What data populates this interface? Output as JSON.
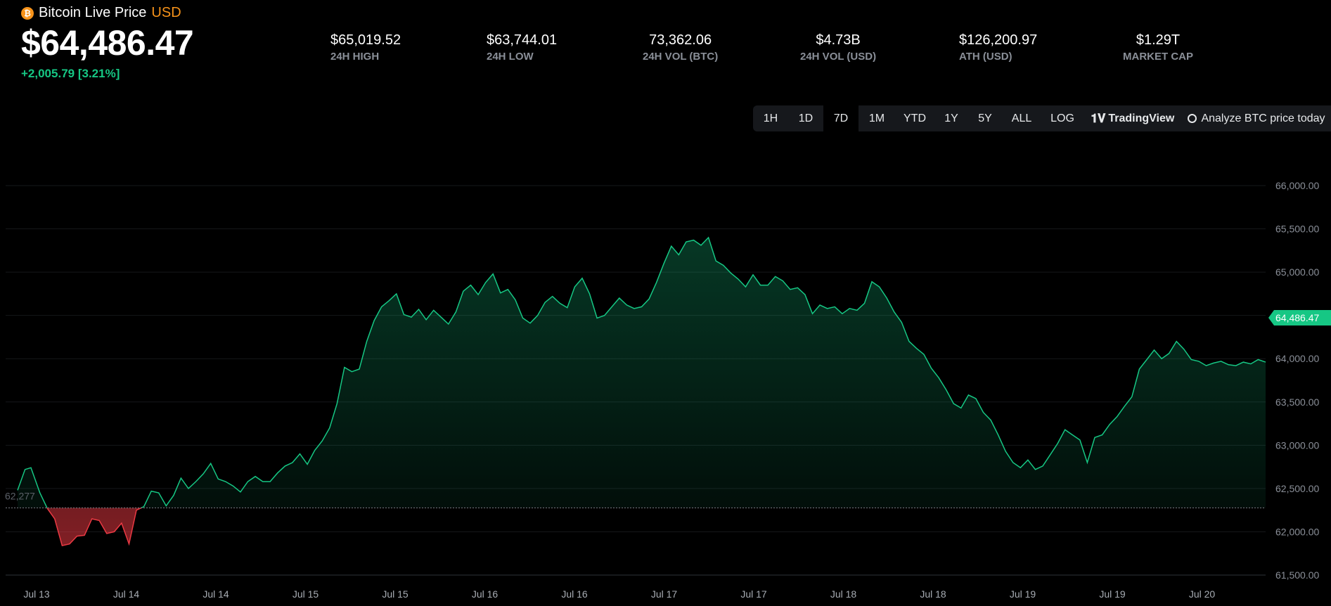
{
  "header": {
    "title": "Bitcoin Live Price",
    "currency": "USD",
    "coin_icon": "bitcoin-icon",
    "price": "$64,486.47",
    "change": "+2,005.79 [3.21%]"
  },
  "stats": [
    {
      "value": "$65,019.52",
      "label": "24H HIGH"
    },
    {
      "value": "$63,744.01",
      "label": "24H LOW"
    },
    {
      "value": "73,362.06",
      "label": "24H VOL (BTC)"
    },
    {
      "value": "$4.73B",
      "label": "24H VOL (USD)"
    },
    {
      "value": "$126,200.97",
      "label": "ATH (USD)"
    },
    {
      "value": "$1.29T",
      "label": "MARKET CAP"
    }
  ],
  "toolbar": {
    "ranges": [
      "1H",
      "1D",
      "7D",
      "1M",
      "YTD",
      "1Y",
      "5Y",
      "ALL"
    ],
    "active_range": "7D",
    "log_label": "LOG",
    "tradingview_label": "TradingView",
    "analyze_label": "Analyze BTC price today"
  },
  "colors": {
    "up": "#16c784",
    "down": "#ea3943",
    "accent": "#f7931a"
  },
  "chart_data": {
    "type": "area",
    "ylim": [
      61500,
      66000
    ],
    "yticks": [
      66000,
      65500,
      65000,
      64500,
      64000,
      63500,
      63000,
      62500,
      62000,
      61500
    ],
    "ytick_labels": [
      "66,000.00",
      "65,500.00",
      "65,000.00",
      "64,500.00",
      "64,000.00",
      "63,500.00",
      "63,000.00",
      "62,500.00",
      "62,000.00",
      "61,500.00"
    ],
    "xtick_labels": [
      "Jul 13",
      "Jul 14",
      "Jul 14",
      "Jul 15",
      "Jul 15",
      "Jul 16",
      "Jul 16",
      "Jul 17",
      "Jul 17",
      "Jul 18",
      "Jul 18",
      "Jul 19",
      "Jul 19",
      "Jul 20"
    ],
    "baseline": 62277,
    "baseline_label": "62,277",
    "current_price_label": "64,486.47",
    "x": [
      0,
      1,
      1.8,
      3,
      4,
      5,
      6,
      7,
      8,
      9,
      10,
      11,
      12,
      13,
      14,
      15,
      16,
      17,
      18,
      19,
      20,
      21,
      22,
      23,
      24,
      25,
      26,
      27,
      28,
      29,
      30,
      31,
      32,
      33,
      34,
      35,
      36,
      37,
      38,
      39,
      40,
      41,
      42,
      43,
      44,
      45,
      46,
      47,
      48,
      49,
      50,
      51,
      52,
      53,
      54,
      55,
      56,
      57,
      58,
      59,
      60,
      61,
      62,
      63,
      64,
      65,
      66,
      67,
      68,
      69,
      70,
      71,
      72,
      73,
      74,
      75,
      76,
      77,
      78,
      79,
      80,
      81,
      82,
      83,
      84,
      85,
      86,
      87,
      88,
      89,
      90,
      91,
      92,
      93,
      94,
      95,
      96,
      97,
      98,
      99,
      100,
      101,
      102,
      103,
      104,
      105,
      106,
      107,
      108,
      109,
      110,
      111,
      112,
      113,
      114,
      115,
      116,
      117,
      118,
      119,
      120,
      121,
      122,
      123,
      124,
      125,
      126,
      127,
      128,
      129,
      130,
      131,
      132,
      133,
      134,
      135,
      136,
      137,
      138,
      139,
      140,
      141,
      142,
      143,
      144,
      145,
      146,
      147,
      148,
      149,
      150,
      151,
      152,
      153,
      154,
      155,
      156,
      157,
      158,
      159,
      160,
      161,
      162,
      163,
      164,
      165,
      166,
      167,
      168
    ],
    "values": [
      62480,
      62720,
      62740,
      62450,
      62270,
      62150,
      61840,
      61860,
      61950,
      61960,
      62150,
      62130,
      61980,
      62000,
      62100,
      61860,
      62250,
      62290,
      62470,
      62450,
      62300,
      62420,
      62620,
      62500,
      62580,
      62670,
      62790,
      62610,
      62580,
      62530,
      62460,
      62580,
      62640,
      62580,
      62580,
      62680,
      62760,
      62800,
      62900,
      62780,
      62940,
      63050,
      63200,
      63480,
      63900,
      63850,
      63880,
      64200,
      64440,
      64600,
      64670,
      64750,
      64510,
      64480,
      64570,
      64450,
      64560,
      64480,
      64400,
      64540,
      64780,
      64850,
      64740,
      64880,
      64980,
      64760,
      64800,
      64680,
      64470,
      64410,
      64500,
      64650,
      64720,
      64640,
      64590,
      64830,
      64930,
      64750,
      64470,
      64500,
      64600,
      64700,
      64620,
      64580,
      64600,
      64690,
      64880,
      65100,
      65300,
      65200,
      65350,
      65370,
      65310,
      65400,
      65130,
      65080,
      64990,
      64920,
      64830,
      64970,
      64850,
      64850,
      64950,
      64900,
      64800,
      64820,
      64740,
      64520,
      64620,
      64580,
      64600,
      64520,
      64580,
      64560,
      64640,
      64890,
      64830,
      64700,
      64540,
      64420,
      64200,
      64120,
      64050,
      63890,
      63780,
      63640,
      63480,
      63430,
      63580,
      63540,
      63380,
      63290,
      63120,
      62930,
      62800,
      62740,
      62830,
      62720,
      62760,
      62890,
      63020,
      63180,
      63120,
      63060,
      62800,
      63090,
      63120,
      63240,
      63330,
      63450,
      63560,
      63880,
      63990,
      64100,
      64000,
      64060,
      64200,
      64110,
      63990,
      63970,
      63920,
      63950,
      63970,
      63930,
      63920,
      63960,
      63940,
      63990,
      63960,
      63960,
      63970,
      63950,
      63990,
      63960
    ]
  }
}
